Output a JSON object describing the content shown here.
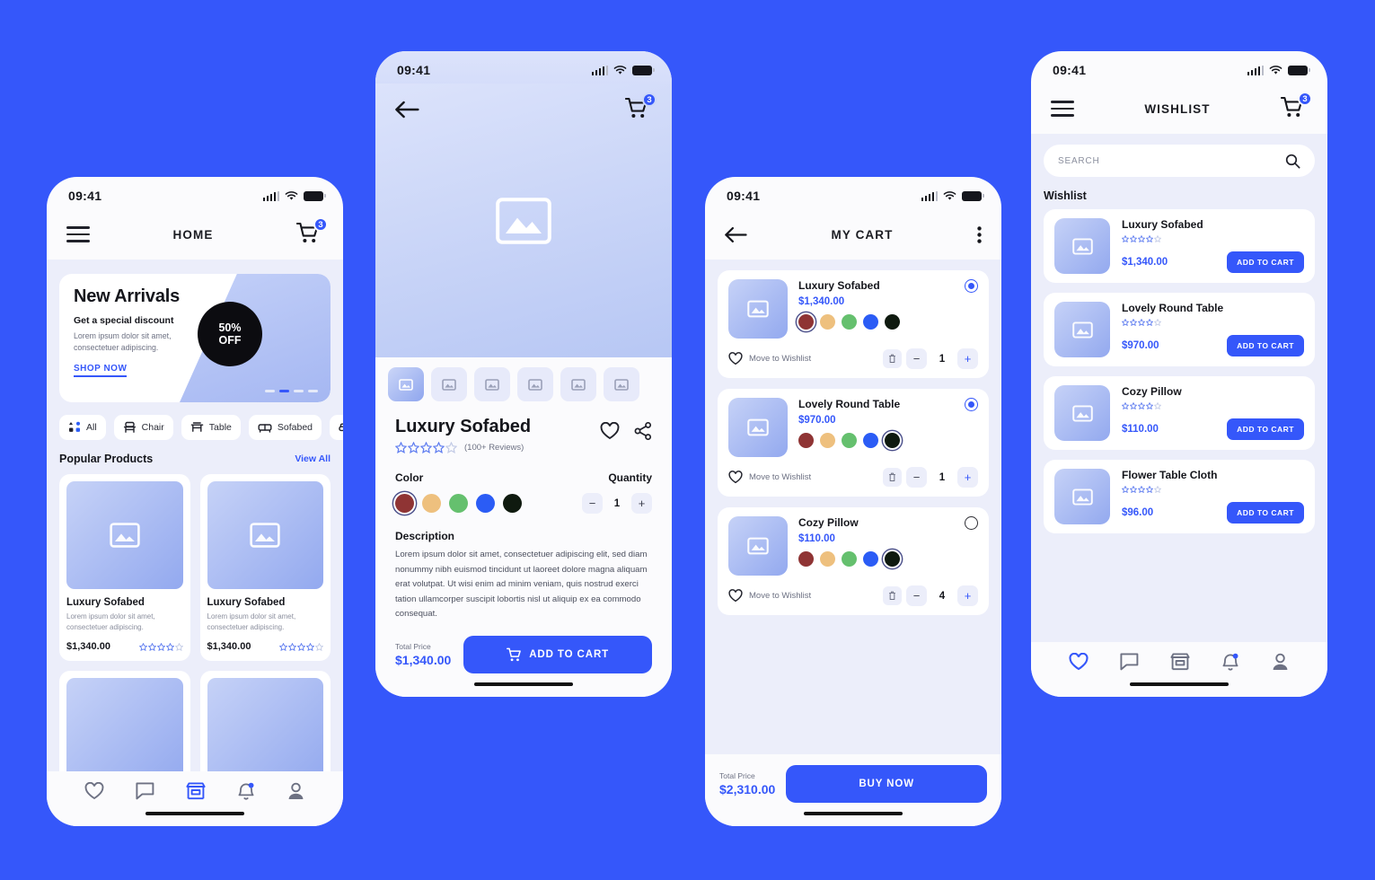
{
  "theme": {
    "background": "#3557fa",
    "accent": "#3557fa",
    "card": "#ffffff",
    "screen_bg": "#eceefa"
  },
  "status_bar": {
    "time": "09:41"
  },
  "swatch_colors": [
    "#8f3434",
    "#eec07e",
    "#65c06e",
    "#2b5cf5",
    "#0f1a0f"
  ],
  "home": {
    "title": "HOME",
    "cart_badge": "3",
    "promo": {
      "title": "New Arrivals",
      "subtitle": "Get a special discount",
      "description": "Lorem ipsum dolor sit amet, consectetuer adipiscing.",
      "cta": "SHOP NOW",
      "discount_line1": "50%",
      "discount_line2": "OFF",
      "dots_active_index": 1,
      "dots_count": 4
    },
    "categories": [
      {
        "label": "All",
        "icon": "grid-icon"
      },
      {
        "label": "Chair",
        "icon": "chair-icon"
      },
      {
        "label": "Table",
        "icon": "table-icon"
      },
      {
        "label": "Sofabed",
        "icon": "sofabed-icon"
      },
      {
        "label": "",
        "icon": "sofa-icon"
      }
    ],
    "section": {
      "title": "Popular Products",
      "link": "View All"
    },
    "products": [
      {
        "name": "Luxury Sofabed",
        "desc": "Lorem ipsum dolor sit amet, consectetuer adipiscing.",
        "price": "$1,340.00",
        "rating": 4
      },
      {
        "name": "Luxury Sofabed",
        "desc": "Lorem ipsum dolor sit amet, consectetuer adipiscing.",
        "price": "$1,340.00",
        "rating": 4
      }
    ],
    "nav": [
      {
        "icon": "heart-icon",
        "active": false
      },
      {
        "icon": "chat-icon",
        "active": false
      },
      {
        "icon": "store-icon",
        "active": true
      },
      {
        "icon": "bell-icon",
        "active": false
      },
      {
        "icon": "person-icon",
        "active": false
      }
    ]
  },
  "detail": {
    "cart_badge": "3",
    "back_icon": "back-arrow-icon",
    "thumbnails_count": 6,
    "thumbnail_active_index": 0,
    "product_name": "Luxury Sofabed",
    "rating": 4,
    "reviews": "(100+ Reviews)",
    "actions": {
      "wishlist_icon": "heart-icon",
      "share_icon": "share-icon"
    },
    "color_label": "Color",
    "selected_color_index": 0,
    "quantity_label": "Quantity",
    "quantity_value": "1",
    "minus_label": "−",
    "plus_label": "+",
    "description_label": "Description",
    "description": "Lorem ipsum dolor sit amet, consectetuer adipiscing elit, sed diam nonummy nibh euismod tincidunt ut laoreet dolore magna aliquam erat volutpat. Ut wisi enim ad minim veniam, quis nostrud exerci tation ullamcorper suscipit lobortis nisl ut aliquip ex ea commodo consequat.",
    "total_price_label": "Total Price",
    "total_price": "$1,340.00",
    "add_to_cart_label": "ADD TO CART"
  },
  "cart": {
    "title": "MY CART",
    "back_icon": "back-arrow-icon",
    "menu_icon": "more-vertical-icon",
    "move_to_wishlist_label": "Move to Wishlist",
    "minus_label": "−",
    "plus_label": "+",
    "items": [
      {
        "name": "Luxury Sofabed",
        "price": "$1,340.00",
        "selected": true,
        "selected_color_index": 0,
        "qty": "1"
      },
      {
        "name": "Lovely Round Table",
        "price": "$970.00",
        "selected": true,
        "selected_color_index": 4,
        "qty": "1"
      },
      {
        "name": "Cozy Pillow",
        "price": "$110.00",
        "selected": false,
        "selected_color_index": 4,
        "qty": "4"
      }
    ],
    "total_price_label": "Total Price",
    "total_price": "$2,310.00",
    "buy_now_label": "BUY NOW"
  },
  "wishlist": {
    "title": "WISHLIST",
    "cart_badge": "3",
    "search_placeholder": "SEARCH",
    "search_value": "",
    "search_icon": "search-icon",
    "section_title": "Wishlist",
    "add_to_cart_label": "ADD TO CART",
    "items": [
      {
        "name": "Luxury Sofabed",
        "price": "$1,340.00",
        "rating": 4
      },
      {
        "name": "Lovely Round Table",
        "price": "$970.00",
        "rating": 4
      },
      {
        "name": "Cozy Pillow",
        "price": "$110.00",
        "rating": 4
      },
      {
        "name": "Flower Table Cloth",
        "price": "$96.00",
        "rating": 4
      }
    ],
    "nav": [
      {
        "icon": "heart-icon",
        "active": true
      },
      {
        "icon": "chat-icon",
        "active": false
      },
      {
        "icon": "store-icon",
        "active": false
      },
      {
        "icon": "bell-icon",
        "active": false
      },
      {
        "icon": "person-icon",
        "active": false
      }
    ]
  }
}
